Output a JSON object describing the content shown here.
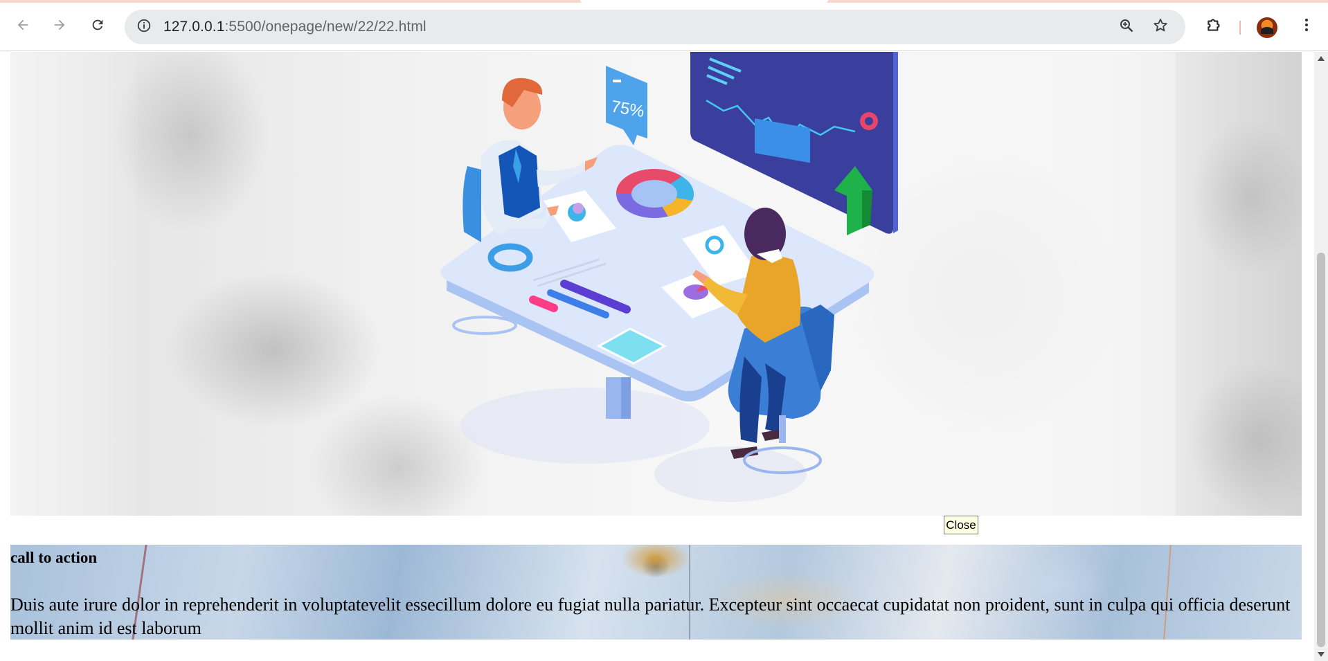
{
  "browser": {
    "url_host": "127.0.0.1",
    "url_rest": ":5500/onepage/new/22/22.html",
    "icons": {
      "back": "arrow-left-icon",
      "forward": "arrow-right-icon",
      "reload": "reload-icon",
      "site_info": "info-icon",
      "zoom": "zoom-icon",
      "bookmark": "star-icon",
      "extensions": "puzzle-icon",
      "profile": "avatar",
      "menu": "kebab-menu-icon"
    },
    "colors": {
      "toolbar": "#ffffff",
      "omnibox": "#e9eaec",
      "tab_strip": "#f7d8cf"
    }
  },
  "hero": {
    "illustration": "business-meeting-illustration",
    "chat_bubble_text": "75%",
    "close_label": "Close"
  },
  "cta": {
    "title": "call to action",
    "text": "Duis aute irure dolor in reprehenderit in voluptatevelit essecillum dolore eu fugiat nulla pariatur. Excepteur sint occaecat cupidatat non proident, sunt in culpa qui officia deserunt mollit anim id est laborum"
  }
}
